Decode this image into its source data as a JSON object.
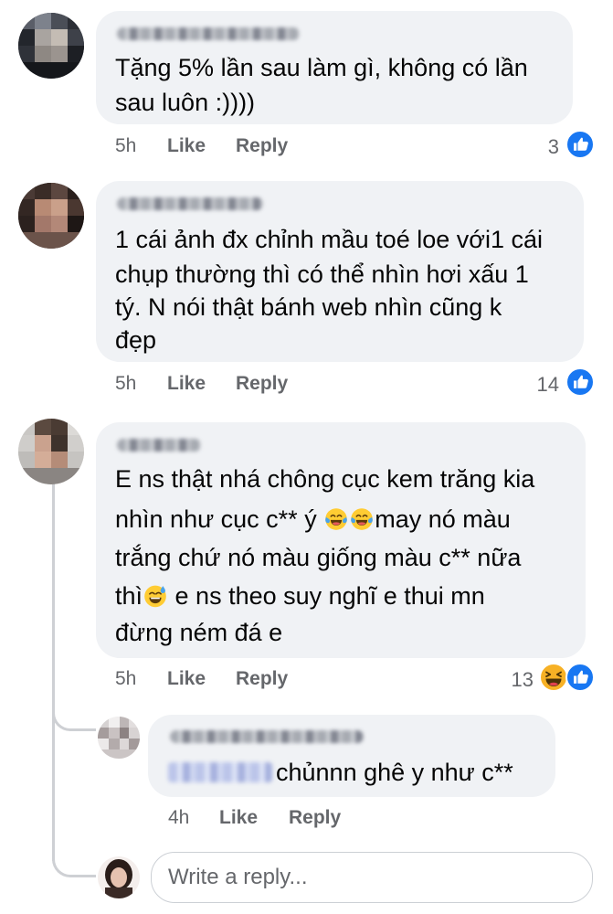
{
  "comments": [
    {
      "text_lines": [
        "Tặng 5% lần sau làm gì, không có lần",
        "sau luôn :))))"
      ],
      "time": "5h",
      "like_label": "Like",
      "reply_label": "Reply",
      "reaction_count": "3",
      "reaction_icons": [
        "like-icon"
      ]
    },
    {
      "text_lines": [
        "1 cái ảnh đx chỉnh mầu toé loe với1 cái",
        "chụp thường thì có thể nhìn hơi xấu 1",
        "tý. N nói thật bánh web nhìn cũng k",
        "đẹp"
      ],
      "time": "5h",
      "like_label": "Like",
      "reply_label": "Reply",
      "reaction_count": "14",
      "reaction_icons": [
        "like-icon"
      ]
    },
    {
      "line1": "E ns thật nhá chông cục kem trăng kia",
      "line2_a": "nhìn như cục c** ý ",
      "line2_b": "may nó màu",
      "line3": "trắng chứ nó màu giống màu c** nữa",
      "line4_a": "thì",
      "line4_b": " e ns theo suy nghĩ e thui mn",
      "line5": "đừng ném đá e",
      "time": "5h",
      "like_label": "Like",
      "reply_label": "Reply",
      "reaction_count": "13",
      "reaction_icons": [
        "haha-icon",
        "like-icon"
      ]
    }
  ],
  "reply": {
    "text": "chủnnn ghê y như c**",
    "time": "4h",
    "like_label": "Like",
    "reply_label": "Reply"
  },
  "reply_box": {
    "placeholder": "Write a reply..."
  },
  "colors": {
    "like_blue": "#1877f2",
    "bubble": "#f0f2f5",
    "meta_gray": "#65676b",
    "thread_line": "#ced0d4"
  }
}
